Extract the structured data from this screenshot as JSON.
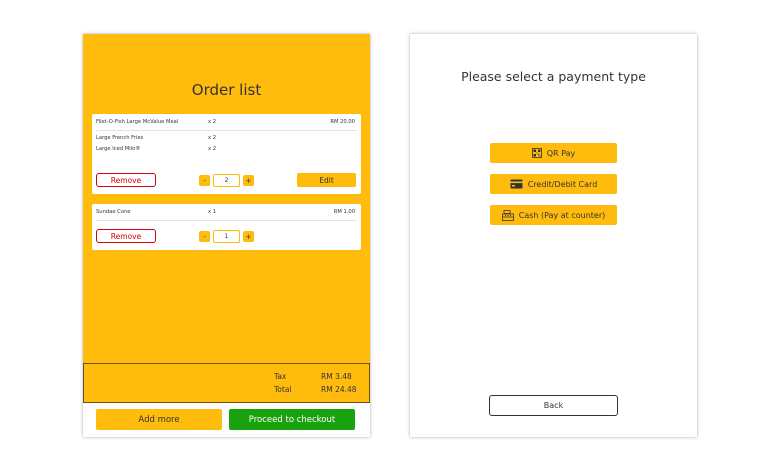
{
  "order": {
    "title": "Order list",
    "items": [
      {
        "rows": [
          {
            "name": "Filet-O-Fish Large McValue Meal",
            "qty": "x 2",
            "price": "RM 20.00"
          },
          {
            "name": "Large French Fries",
            "qty": "x 2",
            "price": ""
          },
          {
            "name": "Large Iced Milo®",
            "qty": "x 2",
            "price": ""
          }
        ],
        "remove_label": "Remove",
        "minus": "-",
        "quantity": "2",
        "plus": "+",
        "edit_label": "Edit"
      },
      {
        "rows": [
          {
            "name": "Sundae Cone",
            "qty": "x 1",
            "price": "RM 1.00"
          }
        ],
        "remove_label": "Remove",
        "minus": "-",
        "quantity": "1",
        "plus": "+"
      }
    ],
    "totals": {
      "tax_label": "Tax",
      "tax_value": "RM 3.48",
      "total_label": "Total",
      "total_value": "RM 24.48"
    },
    "add_more_label": "Add more",
    "checkout_label": "Proceed to checkout"
  },
  "payment": {
    "title": "Please select a payment type",
    "options": [
      {
        "label": "QR Pay",
        "icon": "qr-code-icon"
      },
      {
        "label": "Credit/Debit Card",
        "icon": "credit-card-icon"
      },
      {
        "label": "Cash (Pay at counter)",
        "icon": "cash-register-icon"
      }
    ],
    "back_label": "Back"
  },
  "colors": {
    "brand_yellow": "#ffbc0d",
    "checkout_green": "#1aa10e",
    "remove_red": "#d90007"
  }
}
